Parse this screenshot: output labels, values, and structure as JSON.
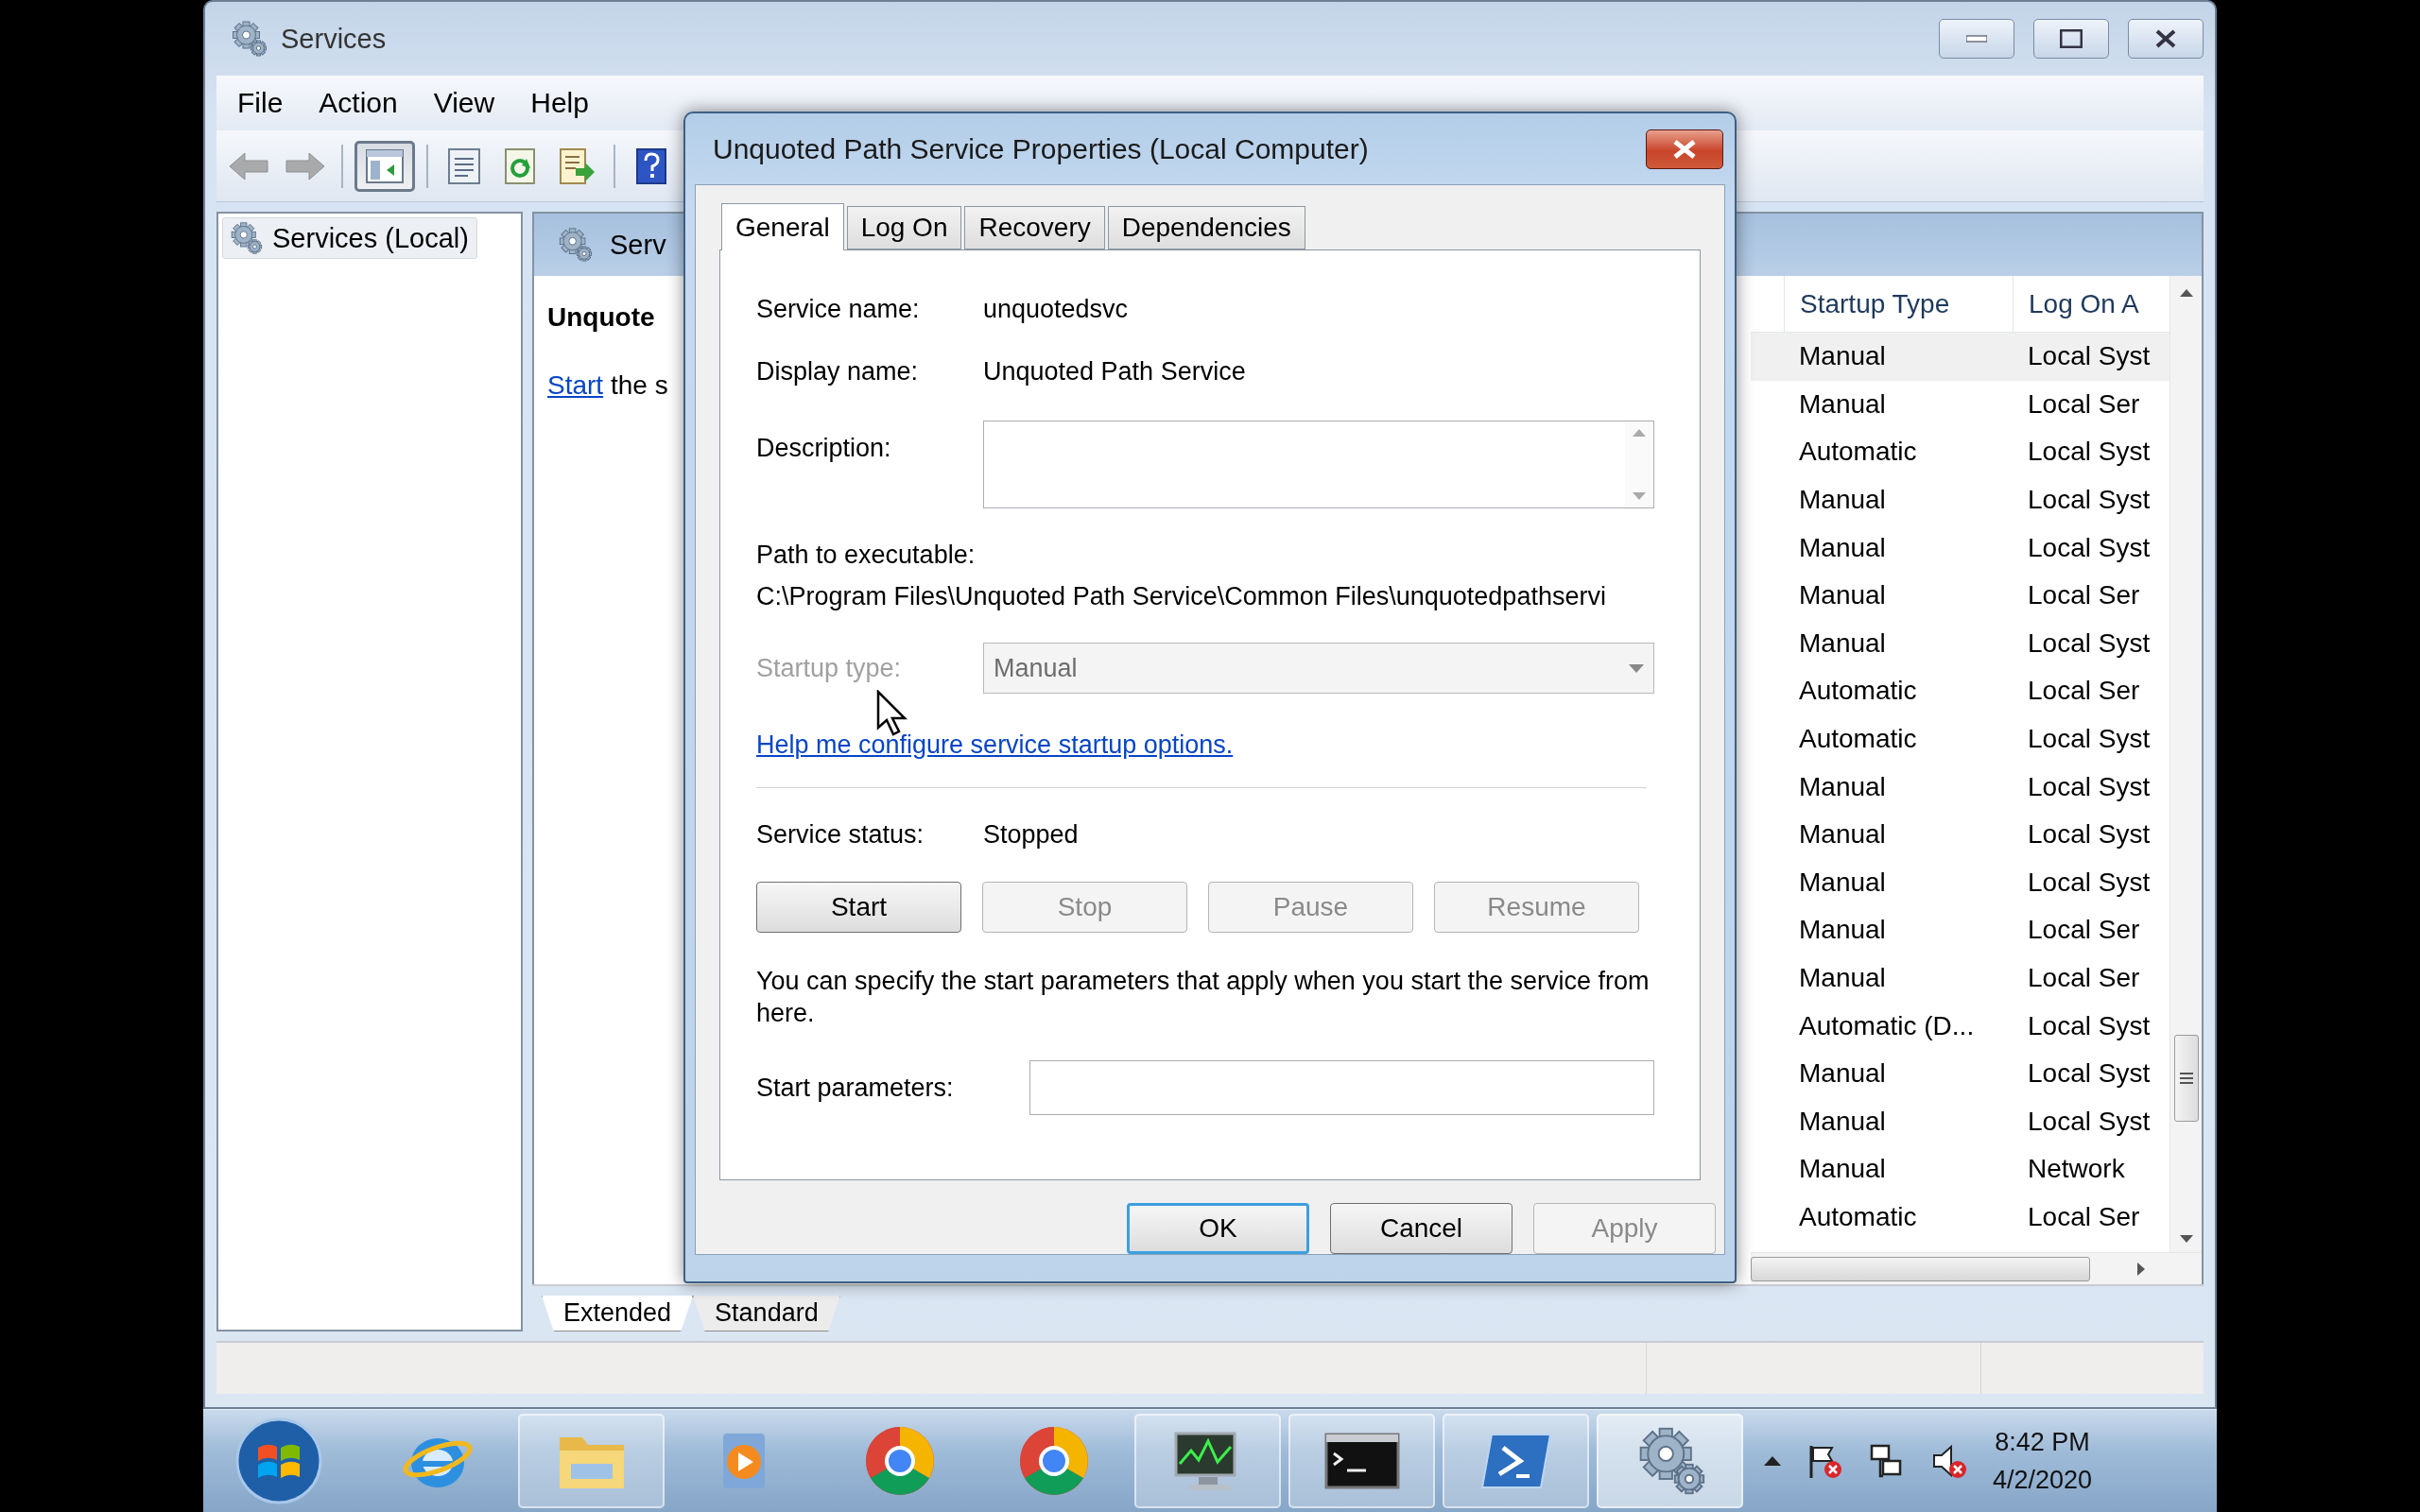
{
  "services_window": {
    "title": "Services",
    "menu": [
      "File",
      "Action",
      "View",
      "Help"
    ],
    "toolbar": [
      {
        "kind": "back",
        "disabled": true,
        "pressed": false
      },
      {
        "kind": "forward",
        "disabled": true,
        "pressed": false
      },
      {
        "kind": "tree",
        "disabled": false,
        "pressed": true
      },
      {
        "kind": "properties",
        "disabled": false,
        "pressed": false
      },
      {
        "kind": "refresh",
        "disabled": false,
        "pressed": false
      },
      {
        "kind": "export",
        "disabled": false,
        "pressed": false
      },
      {
        "kind": "help",
        "disabled": false,
        "pressed": false
      }
    ],
    "tree": [
      {
        "label": "Services (Local)",
        "selected": true
      }
    ],
    "details": {
      "header": "Serv",
      "heading": "Unquote",
      "link": "Start",
      "text": "the s"
    },
    "list": {
      "columns": [
        "Startup Type",
        "Log On A"
      ],
      "rows": [
        {
          "startup_type": "Manual",
          "log_on_as": "Local Syst",
          "selected": true
        },
        {
          "startup_type": "Manual",
          "log_on_as": "Local Ser",
          "selected": false
        },
        {
          "startup_type": "Automatic",
          "log_on_as": "Local Syst",
          "selected": false
        },
        {
          "startup_type": "Manual",
          "log_on_as": "Local Syst",
          "selected": false
        },
        {
          "startup_type": "Manual",
          "log_on_as": "Local Syst",
          "selected": false
        },
        {
          "startup_type": "Manual",
          "log_on_as": "Local Ser",
          "selected": false
        },
        {
          "startup_type": "Manual",
          "log_on_as": "Local Syst",
          "selected": false
        },
        {
          "startup_type": "Automatic",
          "log_on_as": "Local Ser",
          "selected": false
        },
        {
          "startup_type": "Automatic",
          "log_on_as": "Local Syst",
          "selected": false
        },
        {
          "startup_type": "Manual",
          "log_on_as": "Local Syst",
          "selected": false
        },
        {
          "startup_type": "Manual",
          "log_on_as": "Local Syst",
          "selected": false
        },
        {
          "startup_type": "Manual",
          "log_on_as": "Local Syst",
          "selected": false
        },
        {
          "startup_type": "Manual",
          "log_on_as": "Local Ser",
          "selected": false
        },
        {
          "startup_type": "Manual",
          "log_on_as": "Local Ser",
          "selected": false
        },
        {
          "startup_type": "Automatic (D...",
          "log_on_as": "Local Syst",
          "selected": false
        },
        {
          "startup_type": "Manual",
          "log_on_as": "Local Syst",
          "selected": false
        },
        {
          "startup_type": "Manual",
          "log_on_as": "Local Syst",
          "selected": false
        },
        {
          "startup_type": "Manual",
          "log_on_as": "Network",
          "selected": false
        },
        {
          "startup_type": "Automatic",
          "log_on_as": "Local Ser",
          "selected": false
        }
      ]
    },
    "view_tabs": [
      {
        "label": "Extended",
        "selected": true
      },
      {
        "label": "Standard",
        "selected": false
      }
    ]
  },
  "dialog": {
    "title": "Unquoted Path Service Properties (Local Computer)",
    "tabs": [
      {
        "label": "General",
        "selected": true
      },
      {
        "label": "Log On",
        "selected": false
      },
      {
        "label": "Recovery",
        "selected": false
      },
      {
        "label": "Dependencies",
        "selected": false
      }
    ],
    "service_name": {
      "label": "Service name:",
      "value": "unquotedsvc"
    },
    "display_name": {
      "label": "Display name:",
      "value": "Unquoted Path Service"
    },
    "description": {
      "label": "Description:"
    },
    "path": {
      "label": "Path to executable:",
      "value": "C:\\Program Files\\Unquoted Path Service\\Common Files\\unquotedpathservi"
    },
    "startup_type": {
      "label": "Startup type:",
      "value": "Manual",
      "disabled": true
    },
    "help_link": "Help me configure service startup options.",
    "status": {
      "label": "Service status:",
      "value": "Stopped"
    },
    "control_buttons": [
      {
        "label": "Start",
        "disabled": false
      },
      {
        "label": "Stop",
        "disabled": true
      },
      {
        "label": "Pause",
        "disabled": true
      },
      {
        "label": "Resume",
        "disabled": true
      }
    ],
    "note": "You can specify the start parameters that apply when you start the service from here.",
    "start_parameters": {
      "label": "Start parameters:"
    },
    "buttons": [
      {
        "label": "OK",
        "default": true,
        "disabled": false
      },
      {
        "label": "Cancel",
        "default": false,
        "disabled": false
      },
      {
        "label": "Apply",
        "default": false,
        "disabled": true
      }
    ]
  },
  "taskbar": {
    "items": [
      {
        "kind": "browser",
        "open": false,
        "active": false
      },
      {
        "kind": "folder",
        "open": true,
        "active": false
      },
      {
        "kind": "player",
        "open": false,
        "active": false
      },
      {
        "kind": "chrome",
        "open": false,
        "active": false
      },
      {
        "kind": "chrome",
        "open": false,
        "active": false
      },
      {
        "kind": "monitor",
        "open": true,
        "active": false
      },
      {
        "kind": "console",
        "open": true,
        "active": false
      },
      {
        "kind": "shell",
        "open": true,
        "active": false
      },
      {
        "kind": "gears",
        "open": true,
        "active": true
      }
    ],
    "clock": {
      "time": "8:42 PM",
      "date": "4/2/2020"
    }
  }
}
